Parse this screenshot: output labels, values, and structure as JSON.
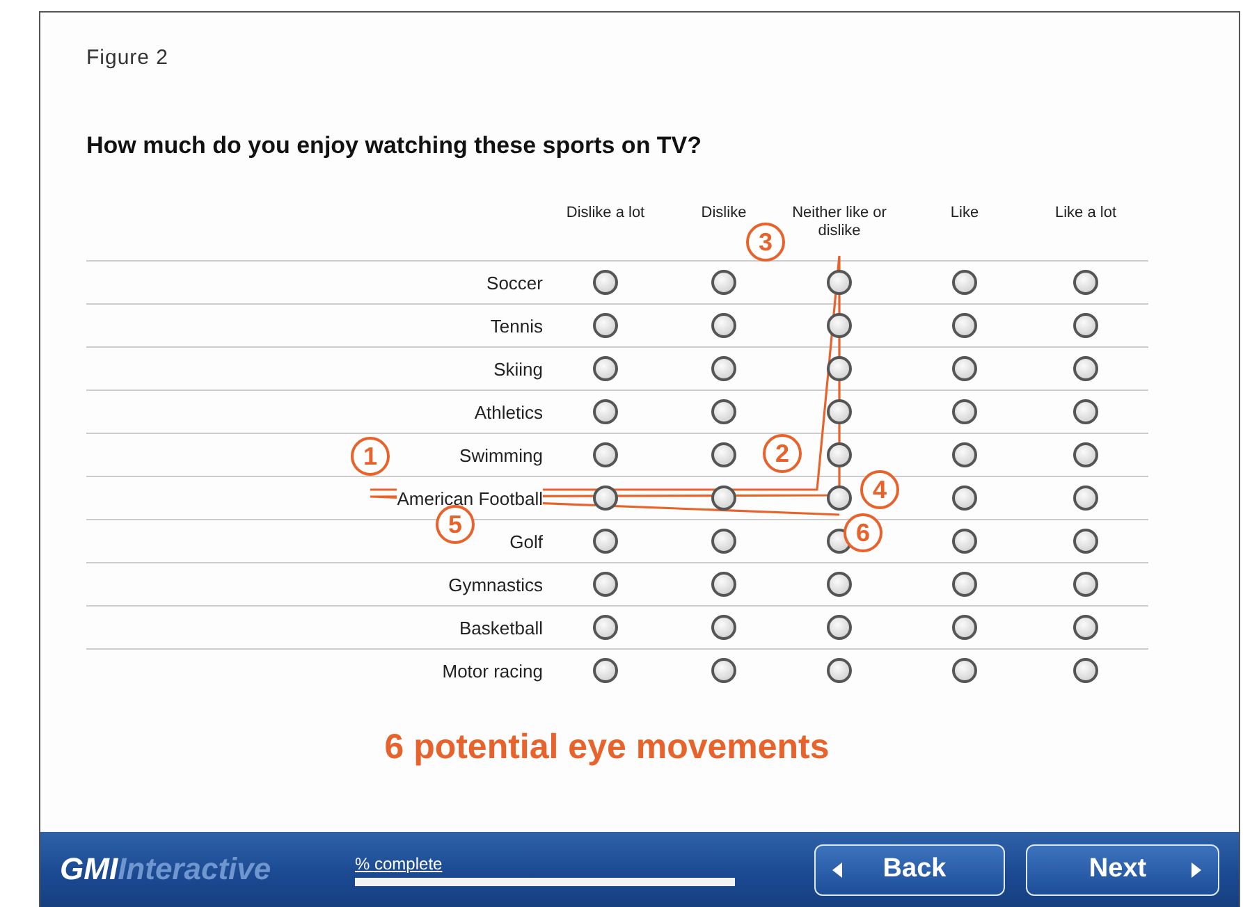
{
  "figure_label": "Figure 2",
  "question": "How much do you enjoy watching these sports on TV?",
  "columns": [
    "Dislike a lot",
    "Dislike",
    "Neither like or dislike",
    "Like",
    "Like a lot"
  ],
  "rows": [
    {
      "label": "Soccer",
      "options": [
        {
          "selected": false
        },
        {
          "selected": false
        },
        {
          "selected": false
        },
        {
          "selected": false
        },
        {
          "selected": false
        }
      ]
    },
    {
      "label": "Tennis",
      "options": [
        {
          "selected": false
        },
        {
          "selected": false
        },
        {
          "selected": false
        },
        {
          "selected": false
        },
        {
          "selected": false
        }
      ]
    },
    {
      "label": "Skiing",
      "options": [
        {
          "selected": false
        },
        {
          "selected": false
        },
        {
          "selected": false
        },
        {
          "selected": false
        },
        {
          "selected": false
        }
      ]
    },
    {
      "label": "Athletics",
      "options": [
        {
          "selected": false
        },
        {
          "selected": false
        },
        {
          "selected": false
        },
        {
          "selected": false
        },
        {
          "selected": false
        }
      ]
    },
    {
      "label": "Swimming",
      "options": [
        {
          "selected": false
        },
        {
          "selected": false
        },
        {
          "selected": false
        },
        {
          "selected": false
        },
        {
          "selected": false
        }
      ]
    },
    {
      "label": "American Football",
      "options": [
        {
          "selected": false
        },
        {
          "selected": false
        },
        {
          "selected": false
        },
        {
          "selected": false
        },
        {
          "selected": false
        }
      ]
    },
    {
      "label": "Golf",
      "options": [
        {
          "selected": false
        },
        {
          "selected": false
        },
        {
          "selected": false
        },
        {
          "selected": false
        },
        {
          "selected": false
        }
      ]
    },
    {
      "label": "Gymnastics",
      "options": [
        {
          "selected": false
        },
        {
          "selected": false
        },
        {
          "selected": false
        },
        {
          "selected": false
        },
        {
          "selected": false
        }
      ]
    },
    {
      "label": "Basketball",
      "options": [
        {
          "selected": false
        },
        {
          "selected": false
        },
        {
          "selected": false
        },
        {
          "selected": false
        },
        {
          "selected": false
        }
      ]
    },
    {
      "label": "Motor racing",
      "options": [
        {
          "selected": false
        },
        {
          "selected": false
        },
        {
          "selected": false
        },
        {
          "selected": false
        },
        {
          "selected": false
        }
      ]
    }
  ],
  "annotations": [
    {
      "label": "1"
    },
    {
      "label": "2"
    },
    {
      "label": "3"
    },
    {
      "label": "4"
    },
    {
      "label": "5"
    },
    {
      "label": "6"
    }
  ],
  "caption": "6 potential eye movements",
  "footer": {
    "logo_bold": "GMI",
    "logo_rest": "Interactive",
    "progress": {
      "label": "% complete"
    },
    "back": "Back",
    "next": "Next"
  }
}
